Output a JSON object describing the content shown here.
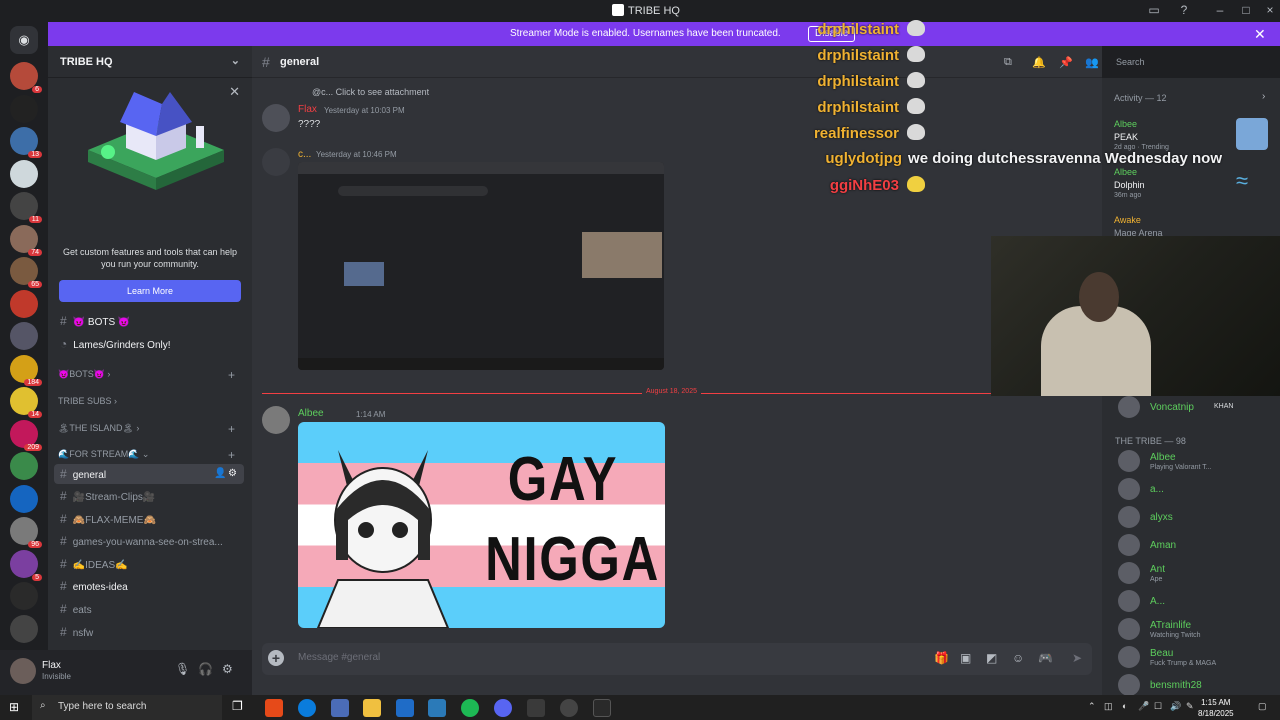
{
  "window": {
    "title": "TRIBE HQ"
  },
  "banner": {
    "text": "Streamer Mode is enabled. Usernames have been truncated.",
    "disable_label": "Disable"
  },
  "servers": [
    {
      "badge": "6"
    },
    {
      "badge": ""
    },
    {
      "badge": "13"
    },
    {
      "badge": ""
    },
    {
      "badge": "11"
    },
    {
      "badge": "74"
    },
    {
      "badge": "65"
    },
    {
      "badge": ""
    },
    {
      "badge": ""
    },
    {
      "badge": "184"
    },
    {
      "badge": "14"
    },
    {
      "badge": "209"
    },
    {
      "badge": ""
    },
    {
      "badge": ""
    },
    {
      "badge": "96"
    },
    {
      "badge": "5"
    },
    {
      "badge": ""
    },
    {
      "badge": ""
    }
  ],
  "guild": {
    "name": "TRIBE HQ"
  },
  "promo": {
    "text": "Get custom features and tools that can help you run your community.",
    "button": "Learn More"
  },
  "channels": {
    "bots_channel": "😈 BOTS 😈",
    "lames": "Lames/Grinders Only!",
    "cat_bots": "😈BOTS😈",
    "cat_subs": "TRIBE SUBS",
    "cat_island": "🏝THE ISLAND🏝",
    "cat_stream": "🌊FOR STREAM🌊",
    "general": "general",
    "clips": "🎥Stream-Clips🎥",
    "memes": "🙈FLAX-MEME🙈",
    "games": "games-you-wanna-see-on-strea...",
    "ideas": "✍️IDEAS✍️",
    "emotes": "emotes-idea",
    "eats": "eats",
    "nsfw": "nsfw"
  },
  "user": {
    "name": "Flax",
    "status": "Invisible"
  },
  "chat": {
    "channel": "general",
    "search_placeholder": "Search",
    "reply_snippet": "@c... Click to see attachment",
    "msg1": {
      "user": "Flax",
      "time": "Yesterday at 10:03 PM",
      "text": "????"
    },
    "msg2": {
      "user": "c...",
      "time": "Yesterday at 10:46 PM"
    },
    "divider_date": "August 18, 2025",
    "msg3": {
      "user": "Albee",
      "time": "1:14 AM",
      "image_text_1": "GAY",
      "image_text_2": "NIGGA"
    },
    "composer_placeholder": "Message #general"
  },
  "activity": {
    "header": "Activity — 12",
    "items": [
      {
        "user": "Albee",
        "title": "PEAK",
        "meta": "2d ago · Trending"
      },
      {
        "user": "Albee",
        "title": "Dolphin",
        "meta": "36m ago"
      },
      {
        "user": "Awake",
        "title": "Mage Arena",
        "meta": ""
      }
    ]
  },
  "members": {
    "voncatnip": "Voncatnip",
    "voncatnip_tag": "KHAN",
    "section": "THE TRIBE — 98",
    "list": [
      {
        "name": "Albee",
        "status": "Playing Valorant T..."
      },
      {
        "name": "a...",
        "status": ""
      },
      {
        "name": "alyxs",
        "status": ""
      },
      {
        "name": "Aman",
        "status": ""
      },
      {
        "name": "Ant",
        "status": "Ape"
      },
      {
        "name": "A...",
        "status": ""
      },
      {
        "name": "ATrainlife",
        "status": "Watching Twitch"
      },
      {
        "name": "Beau",
        "status": "Fuck Trump & MAGA"
      },
      {
        "name": "bensmith28",
        "status": ""
      }
    ]
  },
  "overlay_chat": [
    {
      "user": "drphilstaint",
      "msg": ""
    },
    {
      "user": "drphilstaint",
      "msg": ""
    },
    {
      "user": "drphilstaint",
      "msg": ""
    },
    {
      "user": "drphilstaint",
      "msg": ""
    },
    {
      "user": "realfinessor",
      "msg": ""
    },
    {
      "user": "uglydotjpg",
      "msg": "we doing dutchessravenna Wednesday now"
    },
    {
      "user": "ggiNhE03",
      "msg": ""
    }
  ],
  "taskbar": {
    "search": "Type here to search",
    "time": "1:15 AM",
    "date": "8/18/2025"
  }
}
